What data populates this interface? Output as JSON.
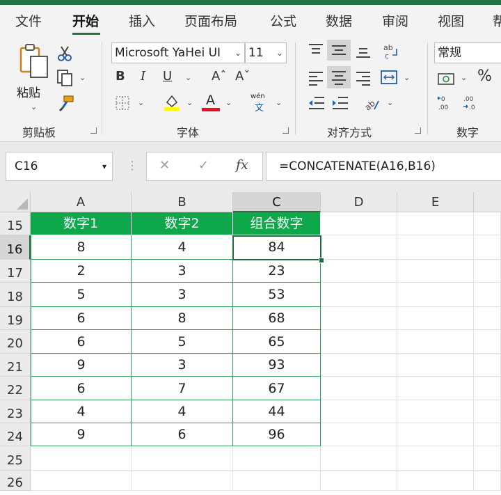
{
  "ribbon_tabs": [
    "文件",
    "开始",
    "插入",
    "页面布局",
    "公式",
    "数据",
    "审阅",
    "视图",
    "帮"
  ],
  "active_tab": "开始",
  "clipboard": {
    "paste_label": "粘贴",
    "group_label": "剪贴板"
  },
  "font": {
    "name": "Microsoft YaHei UI",
    "size": "11",
    "group_label": "字体",
    "bold": "B",
    "italic": "I",
    "underline": "U",
    "grow": "Aˆ",
    "shrink": "Aˇ",
    "font_color_letter": "A",
    "phonetic": "wén",
    "phonetic_char": "文"
  },
  "alignment": {
    "group_label": "对齐方式"
  },
  "number": {
    "format": "常规",
    "group_label": "数字",
    "percent": "%"
  },
  "formula_bar": {
    "name_box": "C16",
    "fx": "fx",
    "cancel": "✕",
    "enter": "✓",
    "formula": "=CONCATENATE(A16,B16)"
  },
  "colors": {
    "accent": "#217346",
    "header_fill": "#0ea84b",
    "table_border": "#2e9d5c"
  },
  "columns": [
    "A",
    "B",
    "C",
    "D",
    "E"
  ],
  "rows": [
    "15",
    "16",
    "17",
    "18",
    "19",
    "20",
    "21",
    "22",
    "23",
    "24",
    "25",
    "26"
  ],
  "table": {
    "headers": [
      "数字1",
      "数字2",
      "组合数字"
    ],
    "data": [
      [
        "8",
        "4",
        "84"
      ],
      [
        "2",
        "3",
        "23"
      ],
      [
        "5",
        "3",
        "53"
      ],
      [
        "6",
        "8",
        "68"
      ],
      [
        "6",
        "5",
        "65"
      ],
      [
        "9",
        "3",
        "93"
      ],
      [
        "6",
        "7",
        "67"
      ],
      [
        "4",
        "4",
        "44"
      ],
      [
        "9",
        "6",
        "96"
      ]
    ]
  },
  "selected_cell": "C16"
}
